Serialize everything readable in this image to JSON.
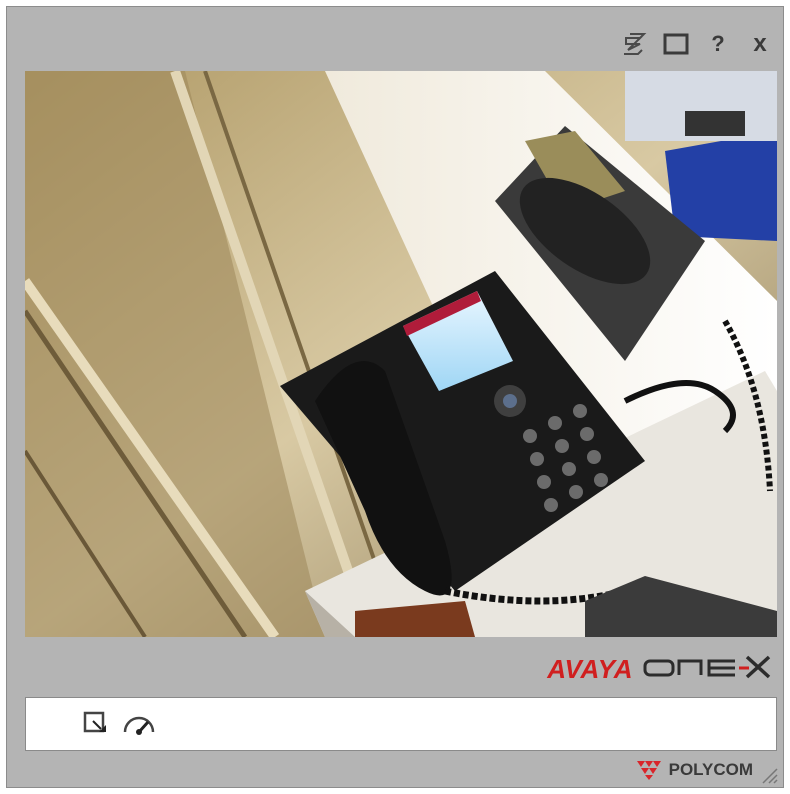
{
  "window": {
    "controls": [
      {
        "name": "layers-icon"
      },
      {
        "name": "maximize-icon"
      },
      {
        "name": "help-icon",
        "label": "?"
      },
      {
        "name": "close-icon",
        "label": "x"
      }
    ]
  },
  "brand": {
    "vendor": "AVAYA",
    "product": "one-X"
  },
  "toolbar": {
    "tools": [
      {
        "name": "select-window-icon"
      },
      {
        "name": "gauge-icon"
      }
    ]
  },
  "footer": {
    "logo_label": "POLYCOM"
  },
  "colors": {
    "window_bg": "#b4b4b4",
    "avaya_red": "#d01f1f",
    "polycom_red": "#d9252a",
    "toolbar_bg": "#ffffff"
  }
}
